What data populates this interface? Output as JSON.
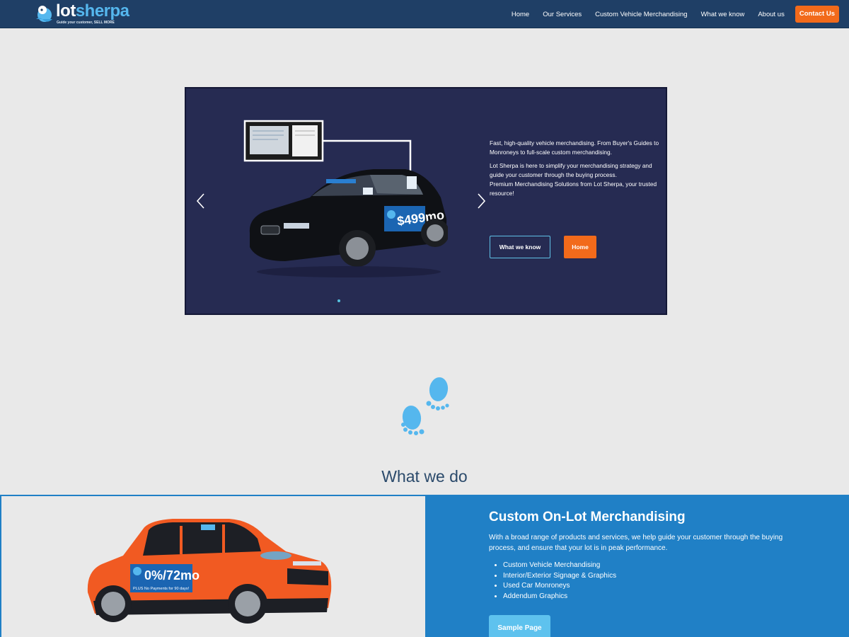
{
  "brand": {
    "name_part1": "lot",
    "name_part2": "sherpa",
    "tagline": "Guide your customer, SELL MORE"
  },
  "nav": {
    "items": [
      {
        "label": "Home"
      },
      {
        "label": "Our Services"
      },
      {
        "label": "Custom Vehicle Merchandising"
      },
      {
        "label": "What we know"
      },
      {
        "label": "About us"
      }
    ],
    "cta": "Contact Us"
  },
  "hero": {
    "paragraph1": "Fast, high-quality vehicle merchandising. From Buyer's Guides to Monroneys to full-scale custom merchandising.",
    "paragraph2": "Lot Sherpa is here to simplify your merchandising strategy and guide your customer through the buying process.",
    "paragraph3": "Premium Merchandising Solutions from Lot Sherpa, your trusted resource!",
    "button_secondary": "What we know",
    "button_primary": "Home",
    "car_price_text": "$499mo"
  },
  "section": {
    "title": "What we do"
  },
  "feature": {
    "title": "Custom On-Lot Merchandising",
    "description": "With a broad range of products and services, we help guide your customer through the buying process, and ensure that your lot is in peak performance.",
    "list": [
      "Custom Vehicle Merchandising",
      "Interior/Exterior Signage & Graphics",
      "Used Car Monroneys",
      "Addendum Graphics"
    ],
    "button": "Sample Page",
    "suv_sign": "0%/72mo",
    "suv_sign_sub": "PLUS No Payments for 90 days!"
  },
  "colors": {
    "nav_bg": "#1f3f66",
    "accent_orange": "#f26a1b",
    "hero_bg": "#262b52",
    "feature_blue": "#2080c6",
    "light_blue": "#5ec2ee"
  }
}
